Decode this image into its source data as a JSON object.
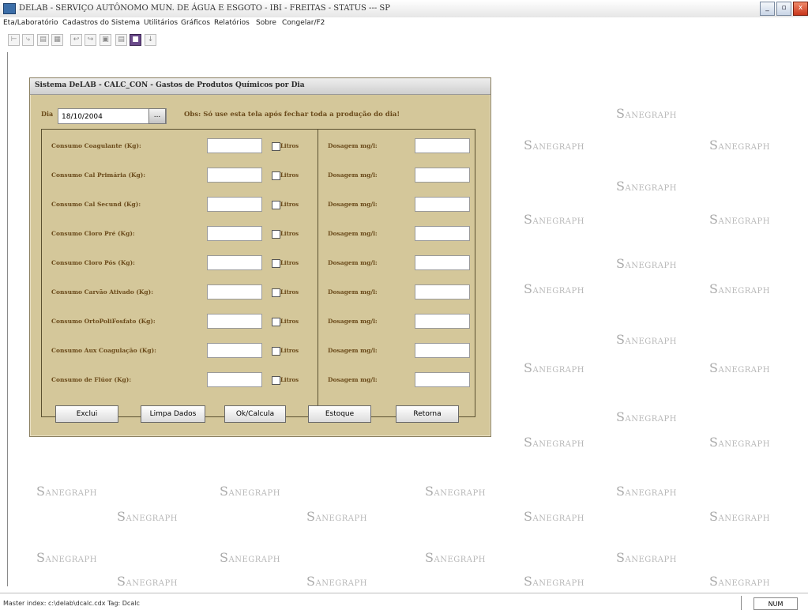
{
  "window": {
    "title": "DELAB - SERVIÇO AUTÔNOMO MUN. DE ÁGUA E ESGOTO - IBI - FREITAS - STATUS --- SP",
    "minimize": "_",
    "maximize": "▫",
    "close": "x"
  },
  "menu": [
    "Eta/Laboratório",
    "Cadastros do Sistema",
    "Utilitários",
    "Gráficos",
    "Relatórios",
    "Sobre",
    "Congelar/F2"
  ],
  "toolbar": [
    "⊢",
    "⤷",
    "▤",
    "▦",
    "↩",
    "↪",
    "▣",
    "▤",
    "■",
    "↓"
  ],
  "dialog": {
    "title": "Sistema DeLAB - CALC_CON - Gastos de Produtos Químicos por Dia",
    "dia_label": "Dia",
    "dia_value": "18/10/2004",
    "date_button": "...",
    "obs": "Obs: Só use esta tela após fechar toda a produção do dia!",
    "rows": [
      {
        "label": "Consumo Coagulante (Kg):",
        "litros": "Litros",
        "dosagem": "Dosagem mg/l:"
      },
      {
        "label": "Consumo Cal Primária (Kg):",
        "litros": "Litros",
        "dosagem": "Dosagem mg/l:"
      },
      {
        "label": "Consumo Cal Secund (Kg):",
        "litros": "Litros",
        "dosagem": "Dosagem mg/l:"
      },
      {
        "label": "Consumo Cloro Pré (Kg):",
        "litros": "Litros",
        "dosagem": "Dosagem mg/l:"
      },
      {
        "label": "Consumo Cloro Pós (Kg):",
        "litros": "Litros",
        "dosagem": "Dosagem mg/l:"
      },
      {
        "label": "Consumo Carvão Ativado (Kg):",
        "litros": "Litros",
        "dosagem": "Dosagem mg/l:"
      },
      {
        "label": "Consumo OrtoPoliFosfato (Kg):",
        "litros": "Litros",
        "dosagem": "Dosagem mg/l:"
      },
      {
        "label": "Consumo Aux Coagulação (Kg):",
        "litros": "Litros",
        "dosagem": "Dosagem mg/l:"
      },
      {
        "label": "Consumo de Flúor (Kg):",
        "litros": "Litros",
        "dosagem": "Dosagem mg/l:"
      }
    ],
    "buttons": {
      "exclui": "Exclui",
      "limpa": "Limpa Dados",
      "ok": "Ok/Calcula",
      "estoque": "Estoque",
      "retorna": "Retorna"
    }
  },
  "watermark": "SANEGRAPH",
  "status": {
    "text": "Master index: c:\\delab\\dcalc.cdx Tag: Dcalc",
    "num": "NUM"
  }
}
